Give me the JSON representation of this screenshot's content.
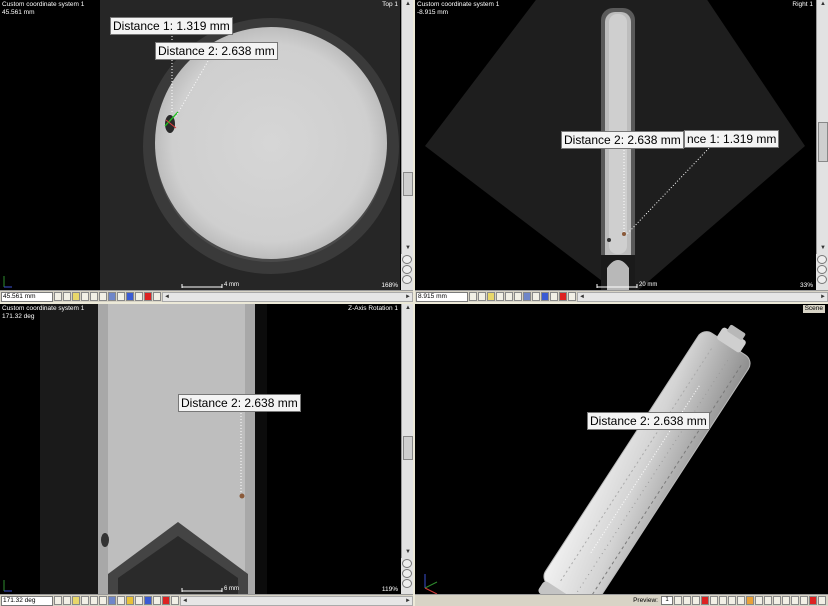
{
  "colors": {
    "active_border": "#2a3fa8",
    "label_bg": "#f4f4f4",
    "toolbar_bg": "#d8d4c6"
  },
  "panes": {
    "top": {
      "coord_system": "Custom coordinate system 1",
      "position": "45.561 mm",
      "view_name": "Top 1",
      "scale": "4 mm",
      "zoom": "168%",
      "toolbar_value": "45.561 mm",
      "labels": {
        "d1": "Distance 1: 1.319 mm",
        "d2": "Distance 2: 2.638 mm"
      }
    },
    "right": {
      "coord_system": "Custom coordinate system 1",
      "position": "-8.915 mm",
      "view_name": "Right 1",
      "scale": "20 mm",
      "zoom": "33%",
      "toolbar_value": "8.915 mm",
      "labels": {
        "d2": "Distance 2: 2.638 mm",
        "d1": "nce 1: 1.319 mm"
      }
    },
    "zaxis": {
      "coord_system": "Custom coordinate system 1",
      "position": "171.32 deg",
      "view_name": "Z-Axis Rotation 1",
      "scale": "6 mm",
      "zoom": "119%",
      "toolbar_value": "171.32 deg",
      "labels": {
        "d2": "Distance 2: 2.638 mm"
      }
    },
    "scene": {
      "view_name": "Scene",
      "preview_label": "Preview:",
      "preview_value": "1",
      "labels": {
        "d2": "Distance 2: 2.638 mm"
      }
    }
  }
}
